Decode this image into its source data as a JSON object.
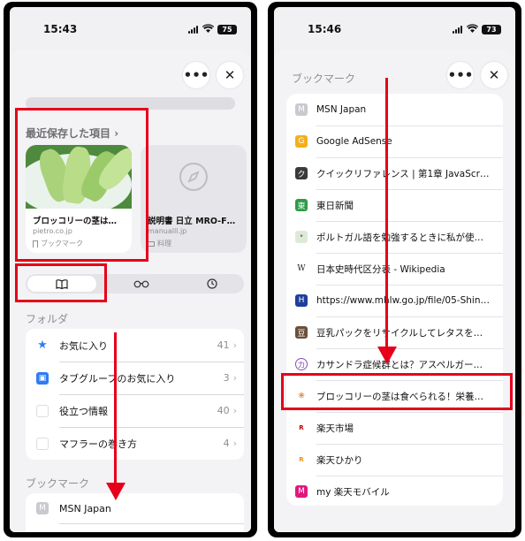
{
  "left": {
    "status": {
      "time": "15:43",
      "battery": "75"
    },
    "more_label": "•••",
    "close_label": "✕",
    "recent": {
      "title": "最近保存した項目",
      "chevron": "›",
      "card1": {
        "title": "ブロッコリーの茎は…",
        "domain": "pietro.co.jp",
        "tag": "ブックマーク"
      },
      "card2": {
        "title": "説明書 日立 MRO-F…",
        "domain": "manualll.jp",
        "tag": "料理"
      }
    },
    "folders": {
      "title": "フォルダ",
      "items": [
        {
          "label": "お気に入り",
          "count": "41",
          "icon": "star-icon",
          "color": "#2f7cf6"
        },
        {
          "label": "タブグループのお気に入り",
          "count": "3",
          "icon": "tab-group-icon",
          "color": "#2f7cf6"
        },
        {
          "label": "役立つ情報",
          "count": "40",
          "icon": "folder-thumbnail-icon",
          "color": "#e04040"
        },
        {
          "label": "マフラーの巻き方",
          "count": "4",
          "icon": "folder-thumbnail-icon",
          "color": "#c9c9cf"
        }
      ]
    },
    "bookmarks": {
      "title": "ブックマーク",
      "first": {
        "letter": "M",
        "label": "MSN Japan"
      }
    }
  },
  "right": {
    "status": {
      "time": "15:46",
      "battery": "73"
    },
    "more_label": "•••",
    "close_label": "✕",
    "title": "ブックマーク",
    "items": [
      {
        "label": "MSN Japan",
        "letter": "M",
        "color": "#c9c9cf"
      },
      {
        "label": "Google AdSense",
        "letter": "G",
        "color": "#f2b01e"
      },
      {
        "label": "クイックリファレンス | 第1章 JavaScr…",
        "letter": "ク",
        "color": "#3a3a3a"
      },
      {
        "label": "東日新聞",
        "letter": "東",
        "color": "#2e9b48"
      },
      {
        "label": "ポルトガル語を勉強するときに私が使…",
        "letter": "•",
        "color": "#dfe9d9"
      },
      {
        "label": "日本史時代区分表 - Wikipedia",
        "letter": "W",
        "color": "#ffffff"
      },
      {
        "label": "https://www.mhlw.go.jp/file/05-Shin…",
        "letter": "H",
        "color": "#1e3f9a"
      },
      {
        "label": "豆乳パックをリサイクルしてレタスを…",
        "letter": "豆",
        "color": "#6a4f3a"
      },
      {
        "label": "カサンドラ症候群とは？アスペルガー…",
        "letter": "カ",
        "color": "#8a4fb8"
      },
      {
        "label": "ブロッコリーの茎は食べられる！栄養…",
        "letter": "❀",
        "color": "#ffffff"
      },
      {
        "label": "楽天市場",
        "letter": "R",
        "color": "#ffffff"
      },
      {
        "label": "楽天ひかり",
        "letter": "R",
        "color": "#ffffff"
      },
      {
        "label": "my 楽天モバイル",
        "letter": "M",
        "color": "#e0187c"
      }
    ]
  }
}
